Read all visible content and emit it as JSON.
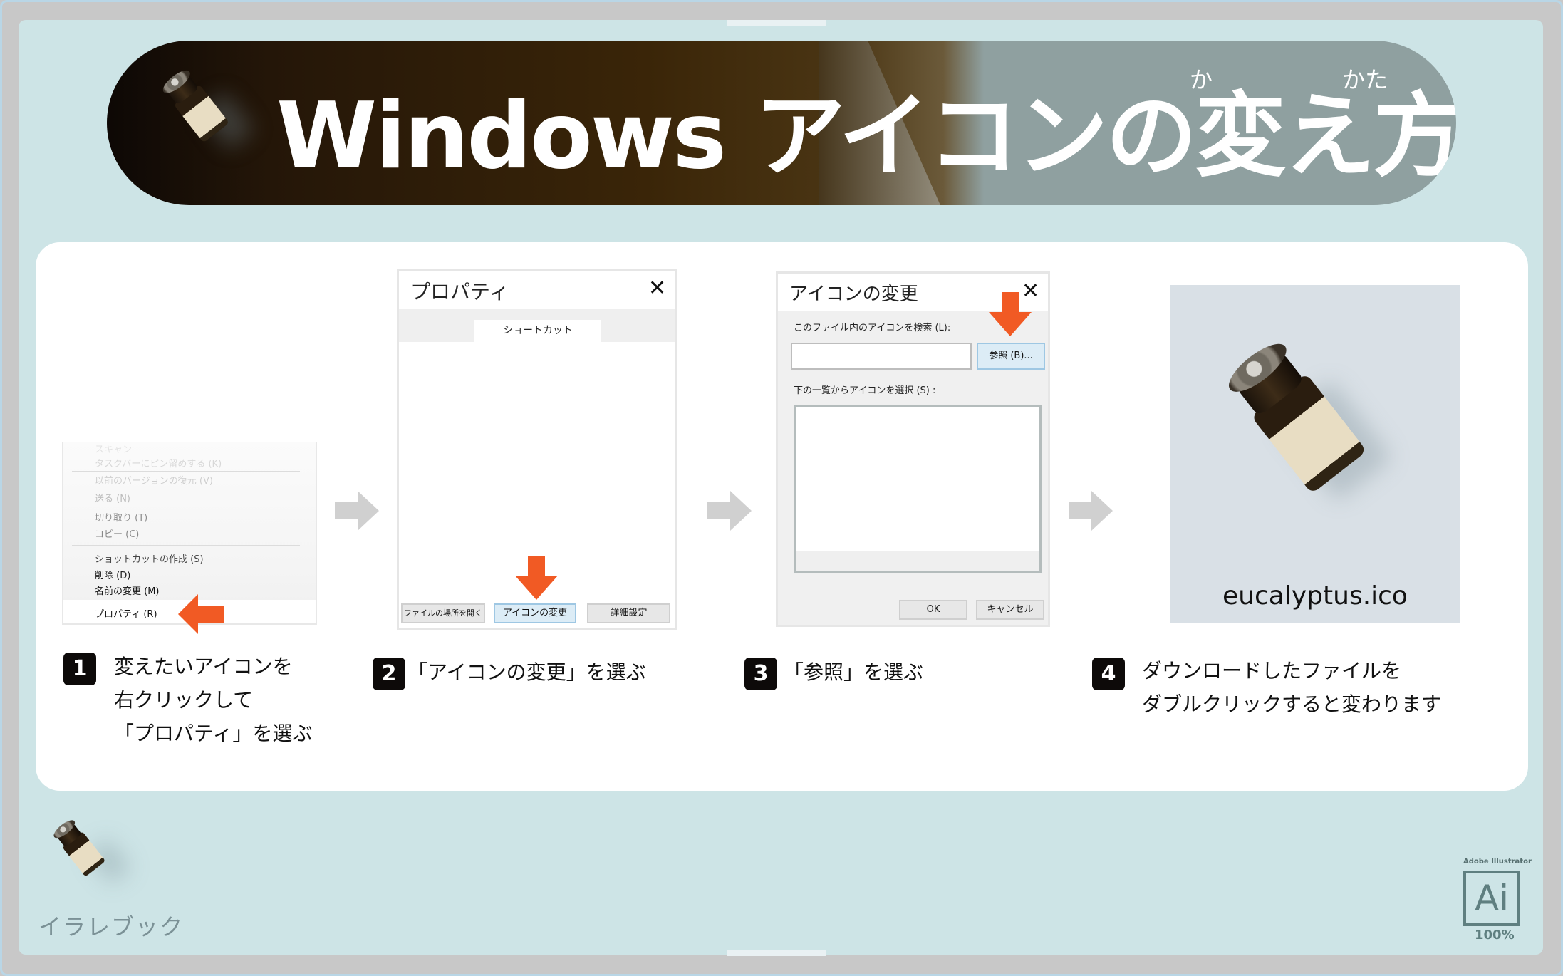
{
  "title": {
    "main": "Windows アイコンの変え方",
    "ruby_ka": "か",
    "ruby_kata": "かた"
  },
  "colors": {
    "accent_orange": "#f15a24",
    "panel_bg": "#cde4e6",
    "arrow_gray": "#d0d0d0"
  },
  "context_menu": {
    "items": [
      {
        "label": "スキャン",
        "faded": true
      },
      {
        "label": "タスクバーにピン留めする (K)",
        "faded": true
      },
      {
        "label": "以前のバージョンの復元 (V)",
        "faded": true
      },
      {
        "label": "送る (N)",
        "faded": true
      },
      {
        "label": "切り取り (T)",
        "faded": true
      },
      {
        "label": "コピー (C)",
        "faded": true
      },
      {
        "label": "ショットカットの作成 (S)",
        "faded": false
      },
      {
        "label": "削除 (D)",
        "faded": false
      },
      {
        "label": "名前の変更 (M)",
        "faded": false
      },
      {
        "label": "プロパティ (R)",
        "faded": false,
        "highlighted": true
      }
    ]
  },
  "properties_dialog": {
    "title": "プロパティ",
    "close_icon": "close-icon",
    "tab": "ショートカット",
    "buttons": [
      "ファイルの場所を開く",
      "アイコンの変更",
      "詳細設定"
    ],
    "active_button": "アイコンの変更"
  },
  "change_icon_dialog": {
    "title": "アイコンの変更",
    "search_label": "このファイル内のアイコンを検索 (L):",
    "path_value": "",
    "browse_button": "参照 (B)...",
    "list_label": "下の一覧からアイコンを選択 (S) :",
    "ok_button": "OK",
    "cancel_button": "キャンセル"
  },
  "preview": {
    "filename": "eucalyptus.ico"
  },
  "steps": [
    {
      "num": "1",
      "text": "変えたいアイコンを\n右クリックして\n「プロパティ」を選ぶ"
    },
    {
      "num": "2",
      "text": "「アイコンの変更」を選ぶ"
    },
    {
      "num": "3",
      "text": "「参照」を選ぶ"
    },
    {
      "num": "4",
      "text": "ダウンロードしたファイルを\nダブルクリックすると変わります"
    }
  ],
  "footer": {
    "brand": "イラレブック",
    "ai_caption": "Adobe Illustrator",
    "ai_label": "Ai",
    "ai_zoom": "100%"
  }
}
